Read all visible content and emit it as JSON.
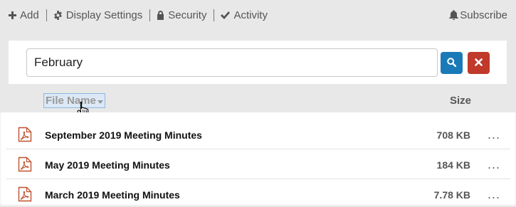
{
  "toolbar": {
    "add_label": "Add",
    "display_settings_label": "Display Settings",
    "security_label": "Security",
    "activity_label": "Activity",
    "subscribe_label": "Subscribe"
  },
  "search": {
    "value": "February"
  },
  "columns": {
    "file_name": "File Name",
    "size": "Size"
  },
  "files": [
    {
      "name": "September 2019 Meeting Minutes",
      "size": "708 KB",
      "type_icon": "pdf-icon"
    },
    {
      "name": "May 2019 Meeting Minutes",
      "size": "184 KB",
      "type_icon": "pdf-icon"
    },
    {
      "name": "March 2019 Meeting Minutes",
      "size": "7.78 KB",
      "type_icon": "pdf-icon"
    }
  ],
  "more_glyph": "...",
  "colors": {
    "search_button": "#1a7ab8",
    "clear_button": "#c0392b",
    "pdf_icon": "#c0502c"
  }
}
